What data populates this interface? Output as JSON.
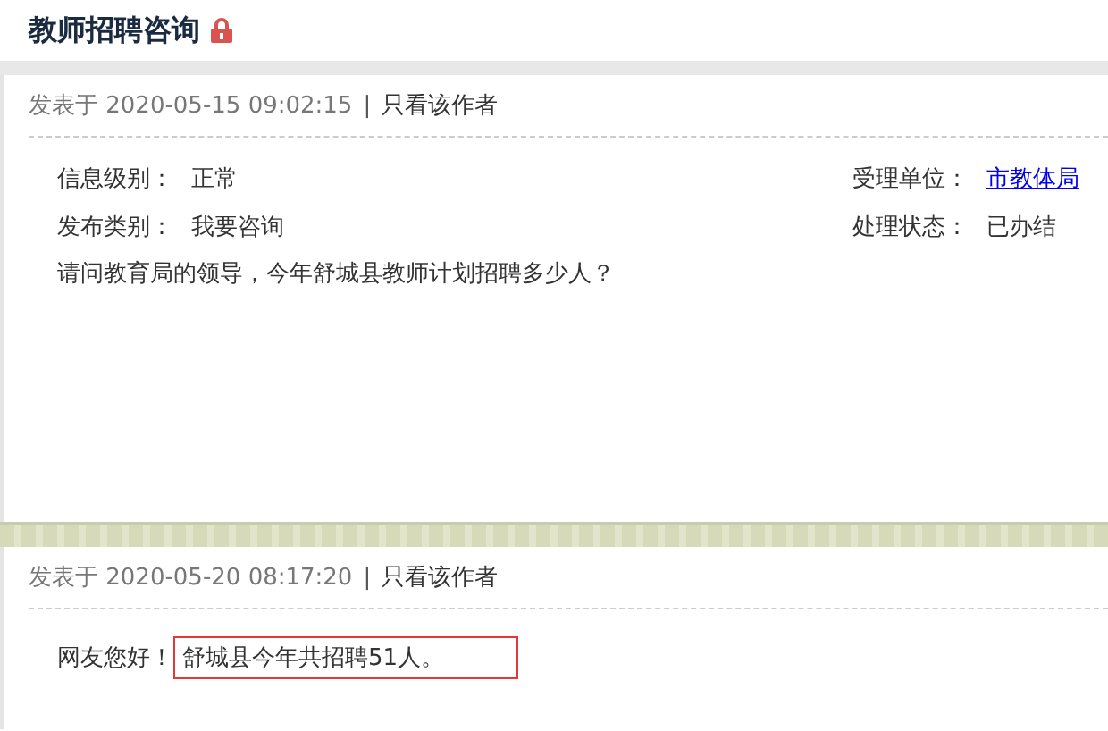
{
  "title": "教师招聘咨询",
  "posts": [
    {
      "kind": "question",
      "posted_label": "发表于",
      "time": "2020-05-15 09:02:15",
      "separator": "|",
      "author_link": "只看该作者",
      "fields_left": [
        {
          "label": "信息级别：",
          "value": "正常"
        },
        {
          "label": "发布类别：",
          "value": "我要咨询"
        }
      ],
      "fields_right": [
        {
          "label": "受理单位：",
          "value": "市教体局",
          "link": true
        },
        {
          "label": "处理状态：",
          "value": "已办结",
          "link": false
        }
      ],
      "content": "请问教育局的领导，今年舒城县教师计划招聘多少人？"
    },
    {
      "kind": "reply",
      "posted_label": "发表于",
      "time": "2020-05-20 08:17:20",
      "separator": "|",
      "author_link": "只看该作者",
      "greeting": "网友您好！",
      "highlight": "舒城县今年共招聘51人。"
    }
  ]
}
